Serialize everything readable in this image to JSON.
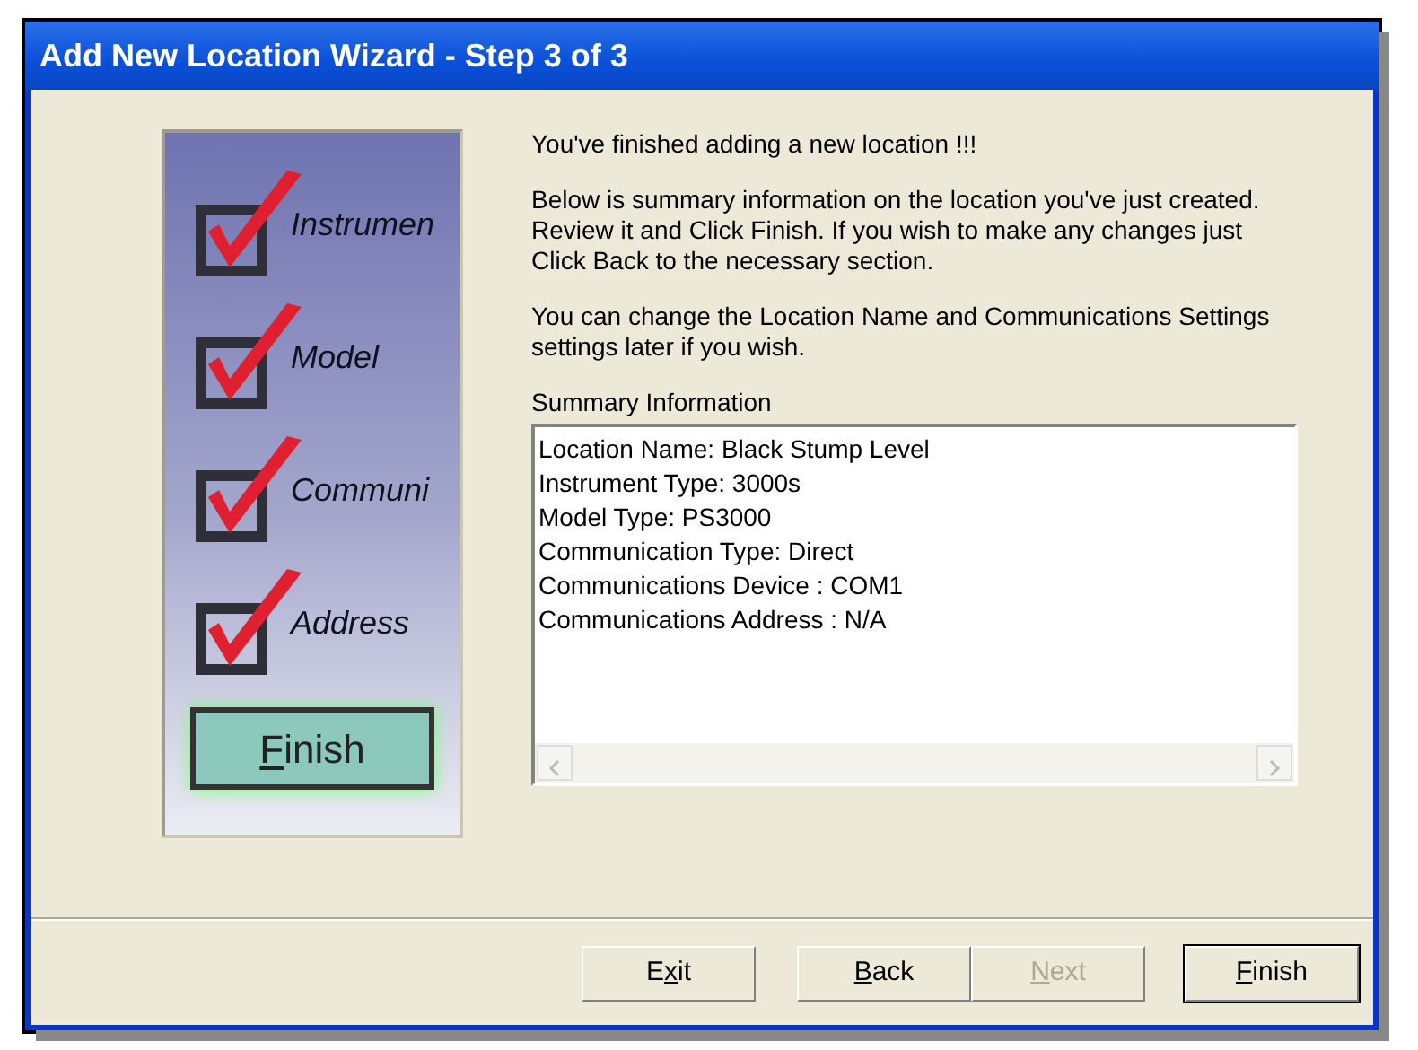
{
  "window": {
    "title": "Add New Location Wizard - Step 3 of 3"
  },
  "side_image": {
    "steps": [
      {
        "label": "Instrumen",
        "checked": true
      },
      {
        "label": "Model",
        "checked": true
      },
      {
        "label": "Communi",
        "checked": true
      },
      {
        "label": "Address",
        "checked": true
      }
    ],
    "button": {
      "key": "F",
      "rest": "inish"
    }
  },
  "paragraphs": [
    "You've finished adding a new location !!!",
    "Below is summary information on the location you've just created.  Review it and Click Finish.  If you wish to make any changes just Click Back to the necessary section.",
    "You can change the Location Name and Communications Settings settings later if you wish."
  ],
  "summary": {
    "label": "Summary Information",
    "lines": [
      "Location Name: Black Stump Level",
      "Instrument Type: 3000s",
      "Model Type: PS3000",
      "Communication Type: Direct",
      "Communications Device : COM1",
      "Communications Address : N/A"
    ]
  },
  "buttons": [
    {
      "lead": "E",
      "key": "x",
      "rest": "it",
      "disabled": false,
      "default": false
    },
    {
      "key": "B",
      "rest": "ack",
      "disabled": false,
      "default": false
    },
    {
      "key": "N",
      "rest": "ext",
      "disabled": true,
      "default": false
    },
    {
      "key": "F",
      "rest": "inish",
      "disabled": false,
      "default": true
    }
  ]
}
